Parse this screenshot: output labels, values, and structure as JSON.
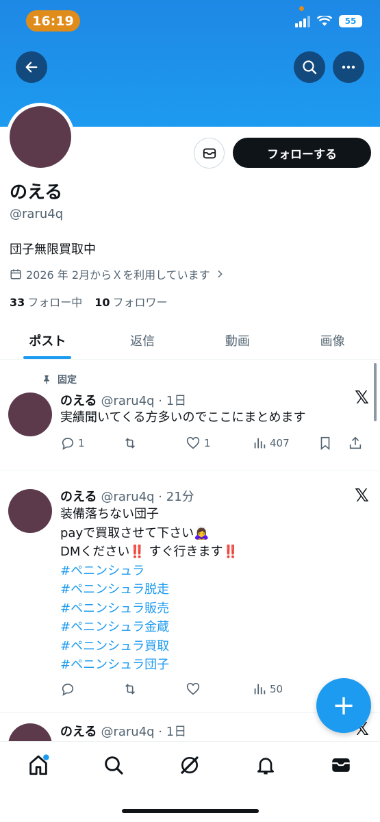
{
  "status_bar": {
    "time": "16:19",
    "battery": "55"
  },
  "header": {
    "back_icon": "arrow-left-icon",
    "search_icon": "search-icon",
    "more_icon": "more-horizontal-icon"
  },
  "profile": {
    "name": "のえる",
    "handle": "@raru4q",
    "bio": "団子無限買取中",
    "joined": "2026 年 2月からＸを利用しています",
    "following_count": "33",
    "following_label": "フォロー中",
    "followers_count": "10",
    "followers_label": "フォロワー",
    "follow_button": "フォローする",
    "message_icon": "mail-icon"
  },
  "tabs": [
    "ポスト",
    "返信",
    "動画",
    "画像"
  ],
  "posts": [
    {
      "pinned_label": "固定",
      "name": "のえる",
      "meta": "@raru4q · 1日",
      "text": "実績聞いてくる方多いのでここにまとめます",
      "replies": "1",
      "retweets": "",
      "likes": "1",
      "views": "407"
    },
    {
      "name": "のえる",
      "meta": "@raru4q · 21分",
      "line1": "装備落ちない団子",
      "line2": "payで買取させて下さい🙇‍♀️",
      "line3": "DMください‼️ すぐ行きます‼️",
      "hashtags": [
        "#ペニンシュラ",
        "#ペニンシュラ脱走",
        "#ペニンシュラ販売",
        "#ペニンシュラ金蔵",
        "#ペニンシュラ買取",
        "#ペニンシュラ団子"
      ],
      "replies": "",
      "retweets": "",
      "likes": "",
      "views": "50"
    },
    {
      "name": "のえる",
      "meta": "@raru4q · 1日"
    }
  ],
  "fab": {
    "label": "+"
  },
  "bottom_nav": [
    "home-icon",
    "search-icon",
    "grok-icon",
    "bell-icon",
    "mail-icon"
  ],
  "colors": {
    "accent": "#1d9bf0",
    "text": "#0f1419",
    "muted": "#536471",
    "avatar": "#5c3a4b",
    "time_pill": "#e08c1a"
  }
}
